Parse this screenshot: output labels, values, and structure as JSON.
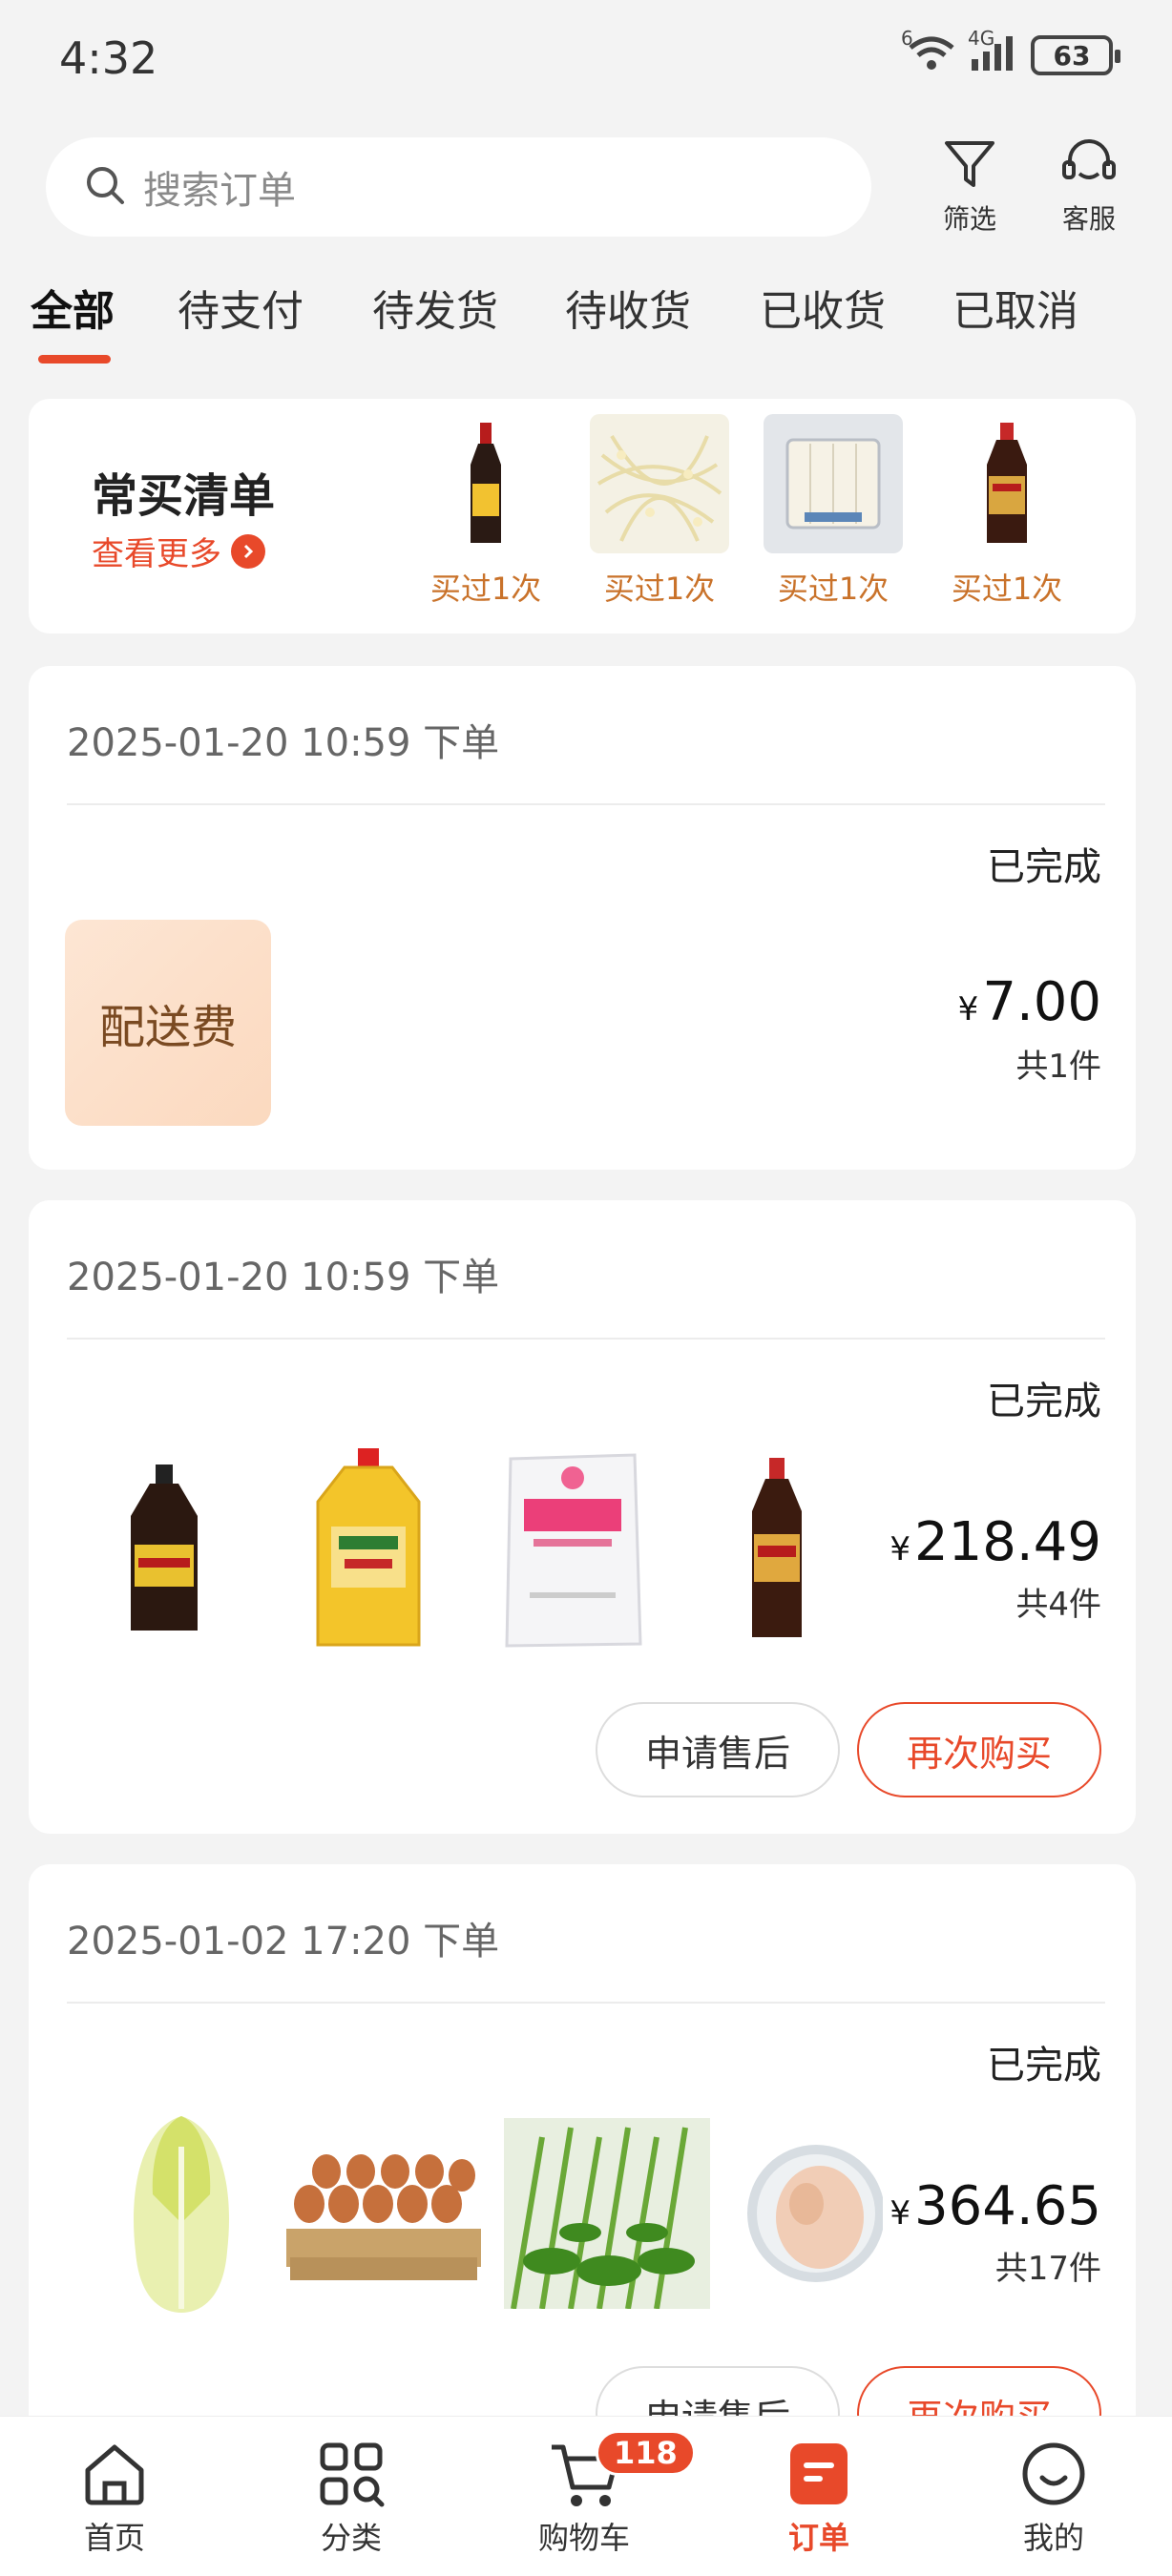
{
  "status": {
    "time": "4:32",
    "battery": "63",
    "net": "4G",
    "sig": "6"
  },
  "search": {
    "placeholder": "搜索订单"
  },
  "actions": {
    "filter": "筛选",
    "service": "客服"
  },
  "tabs": [
    "全部",
    "待支付",
    "待发货",
    "待收货",
    "已收货",
    "已取消"
  ],
  "frequent": {
    "title": "常买清单",
    "more": "查看更多",
    "items": [
      {
        "icon": "soy-sauce-bottle-icon",
        "label": "买过1次"
      },
      {
        "icon": "bean-sprouts-icon",
        "label": "买过1次"
      },
      {
        "icon": "tofu-pack-icon",
        "label": "买过1次"
      },
      {
        "icon": "vinegar-bottle-icon",
        "label": "买过1次"
      }
    ]
  },
  "orders": [
    {
      "date": "2025-01-20 10:59 下单",
      "status": "已完成",
      "yen": "¥",
      "price": "7.00",
      "count": "共1件",
      "delivery_label": "配送费"
    },
    {
      "date": "2025-01-20 10:59 下单",
      "status": "已完成",
      "yen": "¥",
      "price": "218.49",
      "count": "共4件",
      "products": [
        "soy-sauce-jug-icon",
        "cooking-oil-jug-icon",
        "msg-bag-icon",
        "soy-sauce-bottle-icon"
      ],
      "btn_after_sale": "申请售后",
      "btn_rebuy": "再次购买"
    },
    {
      "date": "2025-01-02 17:20 下单",
      "status": "已完成",
      "yen": "¥",
      "price": "364.65",
      "count": "共17件",
      "products": [
        "napa-cabbage-icon",
        "egg-tray-icon",
        "green-vegetable-icon",
        "chicken-plate-icon"
      ],
      "btn_after_sale": "申请售后",
      "btn_rebuy": "再次购买"
    }
  ],
  "nav": {
    "home": "首页",
    "category": "分类",
    "cart": "购物车",
    "cart_badge": "118",
    "orders": "订单",
    "mine": "我的"
  },
  "colors": {
    "accent": "#e8492a",
    "freq_label": "#c9722a"
  }
}
